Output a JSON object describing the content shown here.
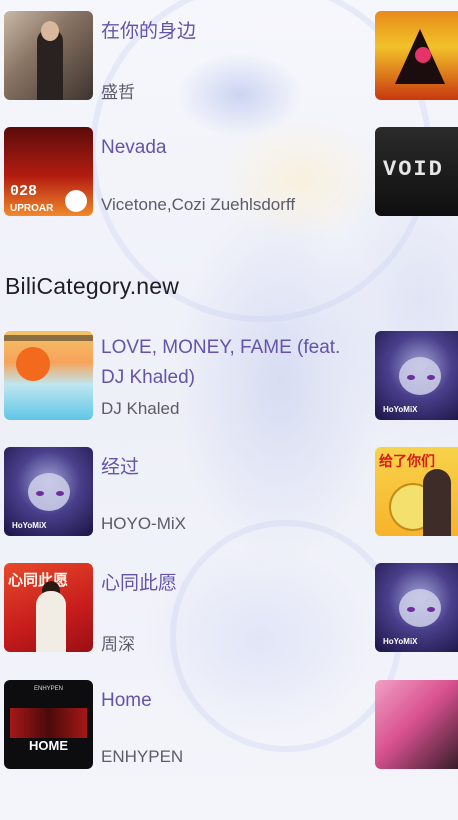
{
  "top_songs": [
    {
      "title": "在你的身边",
      "artist": "盛哲"
    },
    {
      "title": "Nevada",
      "artist": "Vicetone,Cozi Zuehlsdorff"
    }
  ],
  "section": {
    "title": "BiliCategory.new"
  },
  "new_songs": [
    {
      "title": "LOVE, MONEY, FAME (feat. DJ Khaled)",
      "artist": "DJ Khaled"
    },
    {
      "title": "经过",
      "artist": "HOYO-MiX"
    },
    {
      "title": "心同此愿",
      "artist": "周深"
    },
    {
      "title": "Home",
      "artist": "ENHYPEN"
    }
  ],
  "cover_text": {
    "nevada_number": "028",
    "nevada_label": "UPROAR",
    "hoyo_logo": "HoYoMiX",
    "xintong_title": "心同此愿",
    "enhypen_band": "ENHYPEN",
    "enhypen_title": "HOME",
    "void_title": "VOID",
    "yellow_cover_text": "给了你们"
  },
  "colors": {
    "title": "#6653a9",
    "artist": "#5b5b6a",
    "section": "#1e1e24"
  }
}
